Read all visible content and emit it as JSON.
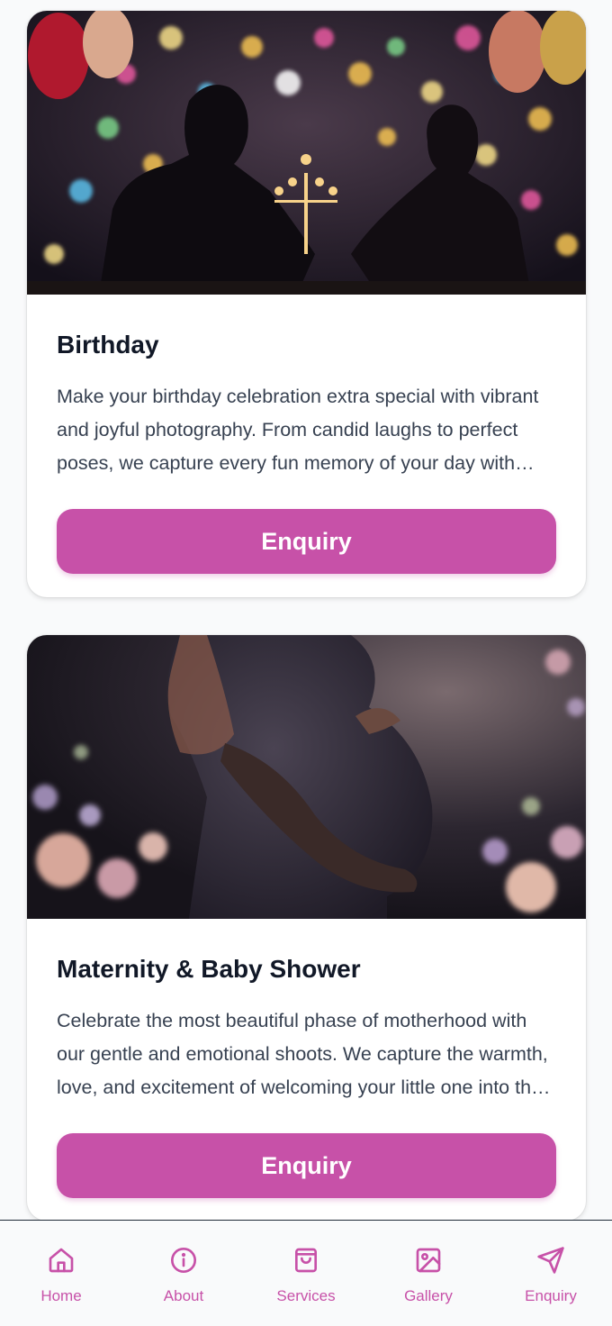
{
  "colors": {
    "accent": "#c751a8",
    "title": "#111827",
    "body": "#374151",
    "background": "#f9fafb"
  },
  "cards": [
    {
      "title": "Birthday",
      "description": "Make your birthday celebration extra special with vibrant and joyful photography. From candid laughs to perfect poses, we capture every fun memory of your day with creativity and care.",
      "button_label": "Enquiry",
      "image": "couple-candlelight-dinner-with-balloons-and-bokeh-lights"
    },
    {
      "title": "Maternity & Baby Shower",
      "description": "Celebrate the most beautiful phase of motherhood with our gentle and emotional shoots. We capture the warmth, love, and excitement of welcoming your little one into the world.",
      "button_label": "Enquiry",
      "image": "pregnant-woman-silhouette-with-flowers"
    }
  ],
  "nav": {
    "items": [
      {
        "label": "Home",
        "icon": "home-icon"
      },
      {
        "label": "About",
        "icon": "info-icon"
      },
      {
        "label": "Services",
        "icon": "shopping-bag-icon"
      },
      {
        "label": "Gallery",
        "icon": "image-icon"
      },
      {
        "label": "Enquiry",
        "icon": "send-icon"
      }
    ]
  }
}
